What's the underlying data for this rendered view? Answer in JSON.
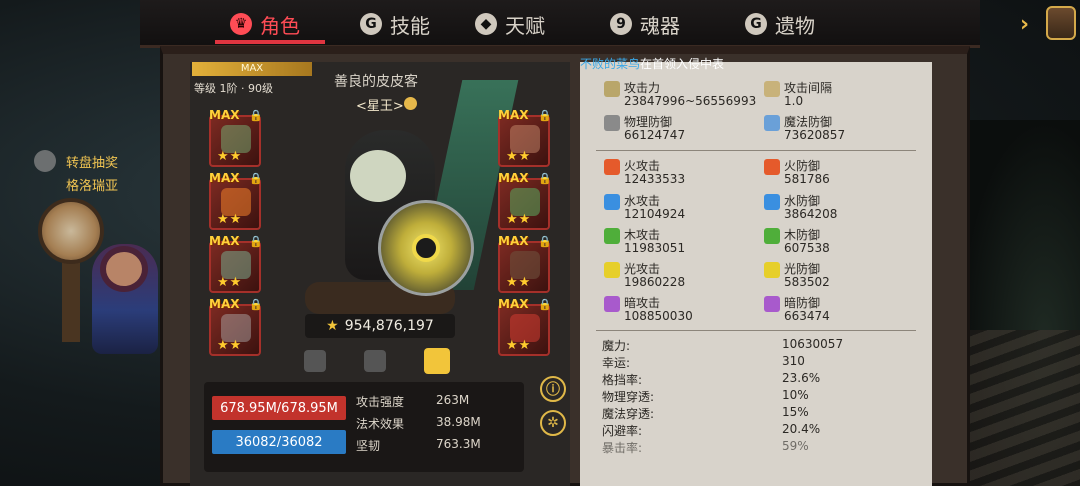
{
  "tabs": [
    {
      "label": "角色",
      "glyph": "♛",
      "active": true
    },
    {
      "label": "技能",
      "glyph": "G",
      "active": false
    },
    {
      "label": "天赋",
      "glyph": "◆",
      "active": false
    },
    {
      "label": "魂器",
      "glyph": "9",
      "active": false
    },
    {
      "label": "遗物",
      "glyph": "G",
      "active": false
    }
  ],
  "side_event": {
    "label": "转盘抽奖",
    "sublabel": "格洛瑞亚"
  },
  "hero": {
    "max_label": "MAX",
    "level_text": "等级 1阶 · 90级",
    "name": "善良的皮皮客",
    "title": "<星王>",
    "power": "954,876,197"
  },
  "equipment_slots": {
    "max_label": "MAX",
    "stars": "★★"
  },
  "bars": {
    "hp": "678.95M/678.95M",
    "mp": "36082/36082"
  },
  "core_stats": [
    {
      "label": "攻击强度",
      "value": "263M"
    },
    {
      "label": "法术效果",
      "value": "38.98M"
    },
    {
      "label": "坚韧",
      "value": "763.3M"
    }
  ],
  "guild": {
    "prefix": "不败的菜鸟",
    "suffix": "在首领入侵中表"
  },
  "attributes": [
    {
      "name": "攻击力",
      "value": "23847996~56556993",
      "color": "#b9a66a"
    },
    {
      "name": "攻击间隔",
      "value": "1.0",
      "color": "#c8b27a"
    },
    {
      "name": "物理防御",
      "value": "66124747",
      "color": "#8a8a8a"
    },
    {
      "name": "魔法防御",
      "value": "73620857",
      "color": "#6aa0d8"
    },
    {
      "name": "火攻击",
      "value": "12433533",
      "color": "#e55a2b"
    },
    {
      "name": "火防御",
      "value": "581786",
      "color": "#e55a2b"
    },
    {
      "name": "水攻击",
      "value": "12104924",
      "color": "#3a8fe0"
    },
    {
      "name": "水防御",
      "value": "3864208",
      "color": "#3a8fe0"
    },
    {
      "name": "木攻击",
      "value": "11983051",
      "color": "#4fae3a"
    },
    {
      "name": "木防御",
      "value": "607538",
      "color": "#4fae3a"
    },
    {
      "name": "光攻击",
      "value": "19860228",
      "color": "#e6cf2a"
    },
    {
      "name": "光防御",
      "value": "583502",
      "color": "#e6cf2a"
    },
    {
      "name": "暗攻击",
      "value": "108850030",
      "color": "#a85acc"
    },
    {
      "name": "暗防御",
      "value": "663474",
      "color": "#a85acc"
    }
  ],
  "extra_stats": [
    {
      "label": "魔力:",
      "value": "10630057"
    },
    {
      "label": "幸运:",
      "value": "310"
    },
    {
      "label": "格挡率:",
      "value": "23.6%"
    },
    {
      "label": "物理穿透:",
      "value": "10%"
    },
    {
      "label": "魔法穿透:",
      "value": "15%"
    },
    {
      "label": "闪避率:",
      "value": "20.4%"
    },
    {
      "label": "暴击率:",
      "value": "59%"
    }
  ]
}
